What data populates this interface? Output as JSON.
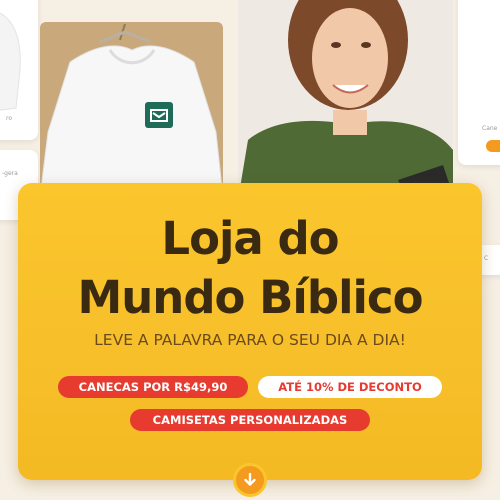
{
  "colors": {
    "banner": "#f7c02b",
    "title": "#3a2a12",
    "subtitle": "#6b4a1c",
    "badge_red": "#e63b2e",
    "badge_white": "#ffffff",
    "accent_orange": "#f39a1f",
    "shirt_logo": "#1f6b5a",
    "model_shirt": "#4f6a35"
  },
  "background": {
    "left_card_text_1": "ro",
    "left_card_text_2": "-gera",
    "right_card_text": "Cane",
    "right_card_badge": "C"
  },
  "banner": {
    "title_line_1": "Loja do",
    "title_line_2": "Mundo Bíblico",
    "subtitle": "LEVE A PALAVRA PARA O SEU DIA A DIA!",
    "badges": [
      "CANECAS POR R$49,90",
      "ATÉ 10% DE DECONTO",
      "CAMISETAS PERSONALIZADAS"
    ],
    "scroll_icon": "arrow-down-icon"
  }
}
